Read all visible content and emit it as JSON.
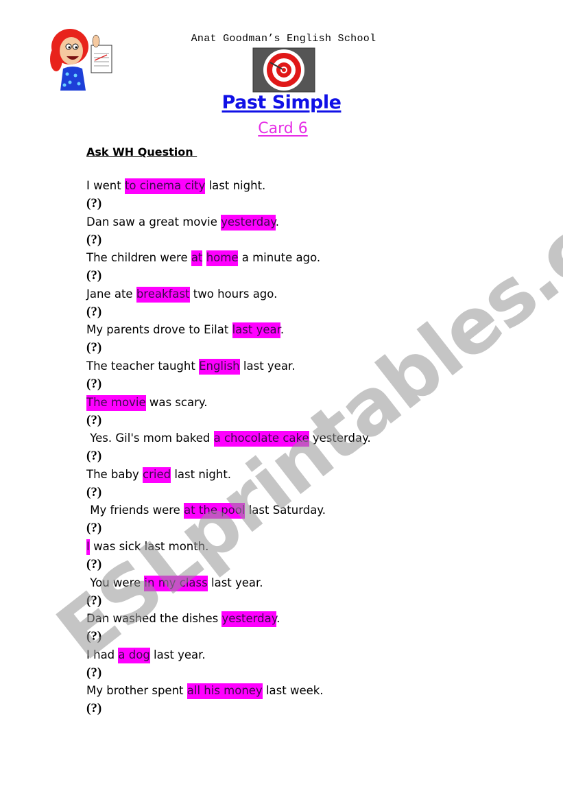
{
  "header": {
    "school_name": "Anat Goodman’s English School",
    "title": "Past Simple",
    "subtitle": "Card 6",
    "colors": {
      "title": "#1010e6",
      "subtitle": "#e62ee6",
      "highlight": "#ff00ff"
    }
  },
  "instructions": "Ask WH Question ",
  "question_placeholder": "(?)",
  "exercises": [
    {
      "before": "I went ",
      "highlight": "to cinema city",
      "after": " last night."
    },
    {
      "before": "Dan saw a great movie ",
      "highlight": "yesterday",
      "after": "."
    },
    {
      "before": "The children were ",
      "highlight": "at",
      "middle": " ",
      "highlight2": "home",
      "after": " a minute ago."
    },
    {
      "before": "Jane ate ",
      "highlight": "breakfast",
      "after": " two hours ago."
    },
    {
      "before": "My parents drove to Eilat ",
      "highlight": "last year",
      "after": "."
    },
    {
      "before": "The teacher taught ",
      "highlight": "English",
      "after": " last year."
    },
    {
      "before": "",
      "highlight": "The movie",
      "after": " was scary."
    },
    {
      "before": " Yes. Gil's mom baked ",
      "highlight": "a chocolate cake",
      "after": " yesterday."
    },
    {
      "before": "The baby ",
      "highlight": "cried",
      "after": " last night."
    },
    {
      "before": " My friends were ",
      "highlight": "at the pool",
      "after": " last Saturday."
    },
    {
      "before": "",
      "highlight": "I",
      "after": " was sick last month."
    },
    {
      "before": " You were ",
      "highlight": "in my class",
      "after": " last year."
    },
    {
      "before": "Dan washed the dishes ",
      "highlight": "yesterday",
      "after": "."
    },
    {
      "before": "I had ",
      "highlight": "a dog",
      "after": " last year."
    },
    {
      "before": "My brother spent ",
      "highlight": "all his money",
      "after": " last week."
    }
  ],
  "watermark": "ESLprintables.com",
  "icons": {
    "teacher": "teacher-holding-paper-icon",
    "logo": "target-logo-icon"
  }
}
